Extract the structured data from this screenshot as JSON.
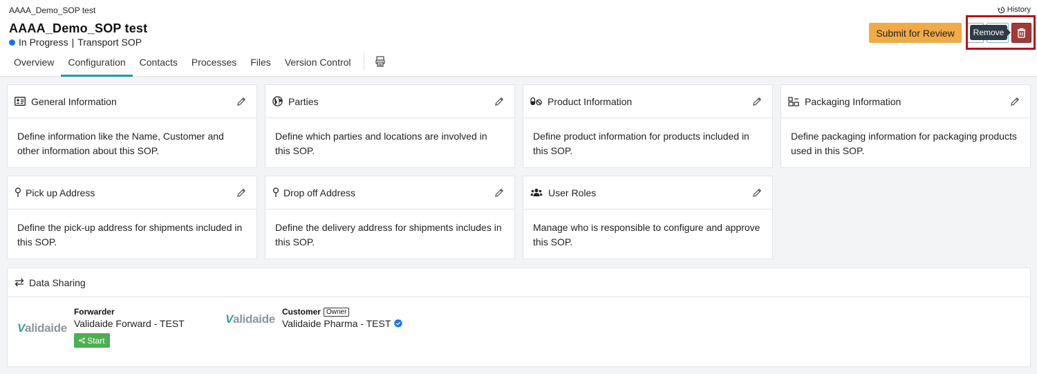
{
  "header": {
    "breadcrumb": "AAAA_Demo_SOP test",
    "history_label": "History",
    "title": "AAAA_Demo_SOP test",
    "status": "In Progress",
    "separator": "|",
    "type": "Transport SOP",
    "submit_label": "Submit for Review",
    "tooltip": "Remove"
  },
  "tabs": [
    "Overview",
    "Configuration",
    "Contacts",
    "Processes",
    "Files",
    "Version Control"
  ],
  "active_tab": "Configuration",
  "cards": [
    {
      "title": "General Information",
      "icon": "id-card-icon",
      "body": "Define information like the Name, Customer and other information about this SOP."
    },
    {
      "title": "Parties",
      "icon": "globe-icon",
      "body": "Define which parties and locations are involved in this SOP."
    },
    {
      "title": "Product Information",
      "icon": "pills-icon",
      "body": "Define product information for products included in this SOP."
    },
    {
      "title": "Packaging Information",
      "icon": "boxes-icon",
      "body": "Define packaging information for packaging products used in this SOP."
    },
    {
      "title": "Pick up Address",
      "icon": "map-pin-icon",
      "body": "Define the pick-up address for shipments included in this SOP."
    },
    {
      "title": "Drop off Address",
      "icon": "map-pin-icon",
      "body": "Define the delivery address for shipments includes in this SOP."
    },
    {
      "title": "User Roles",
      "icon": "users-icon",
      "body": "Manage who is responsible to configure and approve this SOP."
    }
  ],
  "data_sharing": {
    "title": "Data Sharing",
    "parties": [
      {
        "logo_v": "V",
        "logo_rest": "alidaide",
        "role": "Forwarder",
        "name": "Validaide Forward - TEST",
        "action": "Start"
      },
      {
        "logo_v": "V",
        "logo_rest": "alidaide",
        "role": "Customer",
        "badge": "Owner",
        "name": "Validaide Pharma - TEST",
        "verified": true
      }
    ]
  },
  "colors": {
    "submit": "#f0ab45",
    "delete": "#a33a3a",
    "active_tab": "#1f9aa0",
    "status_dot": "#1a73e8",
    "start": "#4caf50",
    "highlight": "#b0151b"
  }
}
